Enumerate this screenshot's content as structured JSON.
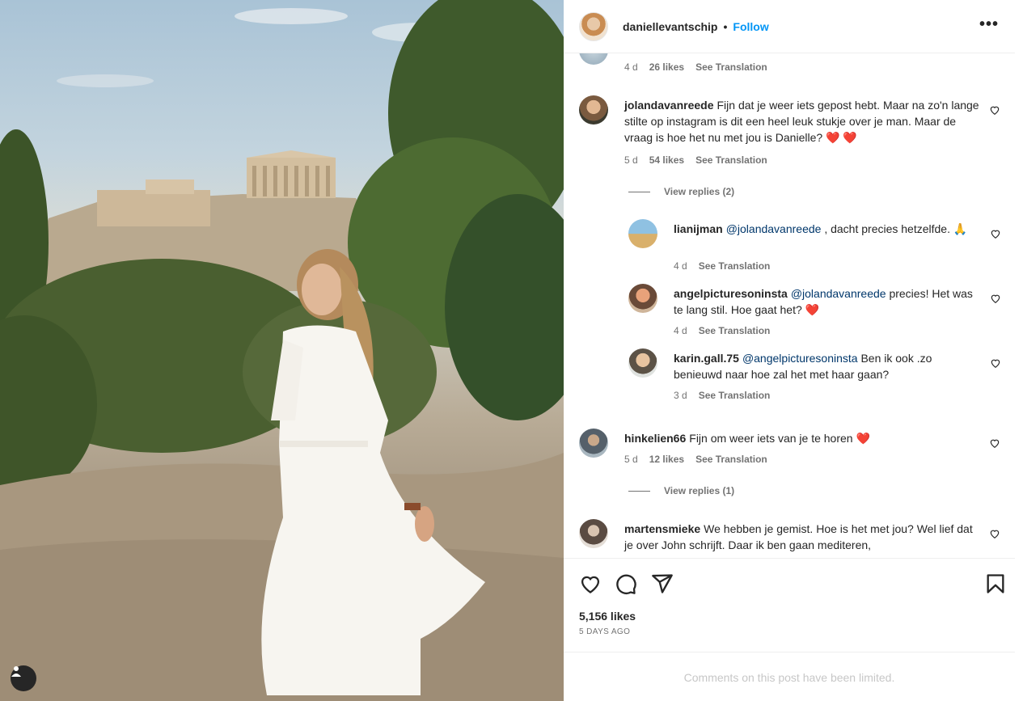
{
  "post": {
    "username": "daniellevantschip",
    "dot": "•",
    "follow_label": "Follow",
    "more_label": "•••"
  },
  "top_meta": {
    "time": "4 d",
    "likes": "26 likes",
    "translate": "See Translation"
  },
  "comments": [
    {
      "username": "jolandavanreede",
      "text": "Fijn dat je weer iets gepost hebt. Maar na zo'n lange stilte op instagram is dit een heel leuk stukje over je man. Maar de vraag is hoe het nu met jou is Danielle? ❤️ ❤️",
      "time": "5 d",
      "likes": "54 likes",
      "translate": "See Translation",
      "view_replies": "View replies (2)"
    },
    {
      "username": "lianijman",
      "mention": "@jolandavanreede",
      "text": " , dacht precies hetzelfde. 🙏",
      "time": "4 d",
      "translate": "See Translation"
    },
    {
      "username": "angelpicturesoninsta",
      "mention": "@jolandavanreede",
      "text": " precies! Het was te lang stil. Hoe gaat het? ❤️",
      "time": "4 d",
      "translate": "See Translation"
    },
    {
      "username": "karin.gall.75",
      "mention": "@angelpicturesoninsta",
      "text": " Ben ik ook .zo benieuwd naar hoe zal het met haar gaan?",
      "time": "3 d",
      "translate": "See Translation"
    },
    {
      "username": "hinkelien66",
      "text": "Fijn om weer iets van je te horen ❤️",
      "time": "5 d",
      "likes": "12 likes",
      "translate": "See Translation",
      "view_replies": "View replies (1)"
    },
    {
      "username": "martensmieke",
      "text": "We hebben je gemist. Hoe is het met jou? Wel lief dat je over John schrijft. Daar ik ben gaan mediteren,"
    }
  ],
  "footer": {
    "likes": "5,156 likes",
    "time_ago": "5 DAYS AGO",
    "limited": "Comments on this post have been limited."
  },
  "colors": {
    "follow": "#0095f6",
    "mention": "#00376b",
    "muted": "#737373"
  }
}
